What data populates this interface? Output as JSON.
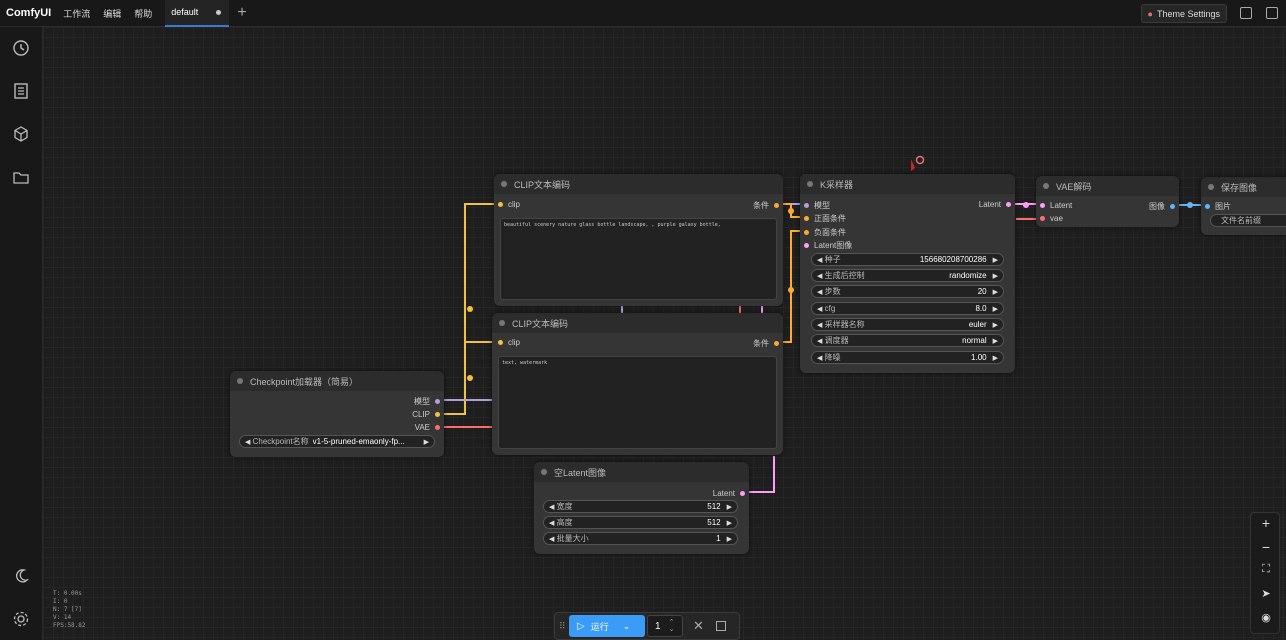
{
  "app": {
    "logo": "ComfyUI"
  },
  "menu": [
    "工作流",
    "编辑",
    "帮助"
  ],
  "tab": {
    "label": "default"
  },
  "theme_button": "Theme Settings",
  "nodes": {
    "clip1": {
      "title": "CLIP文本编码",
      "input": "clip",
      "output": "条件",
      "text": "beautiful scenery nature glass bottle landscape, , purple galaxy bottle,"
    },
    "clip2": {
      "title": "CLIP文本编码",
      "input": "clip",
      "output": "条件",
      "text": "text, watermark"
    },
    "ksampler": {
      "title": "K采样器",
      "inputs": [
        "模型",
        "正面条件",
        "负面条件",
        "Latent图像"
      ],
      "output": "Latent",
      "widgets": [
        {
          "label": "种子",
          "value": "156680208700286"
        },
        {
          "label": "生成后控制",
          "value": "randomize"
        },
        {
          "label": "步数",
          "value": "20"
        },
        {
          "label": "cfg",
          "value": "8.0"
        },
        {
          "label": "采样器名称",
          "value": "euler"
        },
        {
          "label": "调度器",
          "value": "normal"
        },
        {
          "label": "降噪",
          "value": "1.00"
        }
      ]
    },
    "vae": {
      "title": "VAE解码",
      "inputs": [
        "Latent",
        "vae"
      ],
      "output": "图像"
    },
    "save": {
      "title": "保存图像",
      "input": "图片",
      "widget": "文件名前缀"
    },
    "checkpoint": {
      "title": "Checkpoint加载器（简易）",
      "outputs": [
        "模型",
        "CLIP",
        "VAE"
      ],
      "widget_label": "Checkpoint名称",
      "widget_value": "v1-5-pruned-emaonly-fp..."
    },
    "latent": {
      "title": "空Latent图像",
      "output": "Latent",
      "widgets": [
        {
          "label": "宽度",
          "value": "512"
        },
        {
          "label": "高度",
          "value": "512"
        },
        {
          "label": "批量大小",
          "value": "1"
        }
      ]
    }
  },
  "stats": [
    "T: 0.00s",
    "I: 0",
    "N: 7 [7]",
    "V: 14",
    "FPS:58.82"
  ],
  "runbar": {
    "run_label": "运行",
    "batch_count": "1"
  },
  "colors": {
    "clip": "#f3c141",
    "model": "#b39ddb",
    "vae": "#ff6e6e",
    "latent": "#ff9cf9",
    "conditioning": "#ffa931",
    "image": "#64b5f6",
    "accent": "#3b9cf7"
  }
}
